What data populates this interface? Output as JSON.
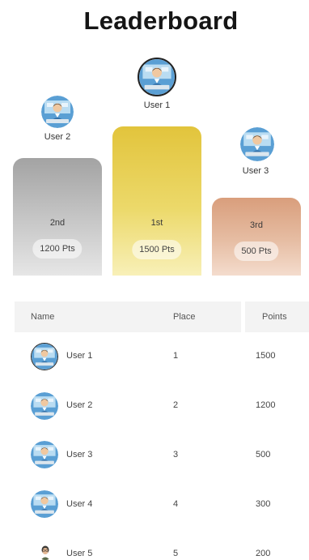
{
  "header": {
    "title": "Leaderboard"
  },
  "podium": [
    {
      "rank": 2,
      "user": "User 2",
      "place": "2nd",
      "points": "1200 Pts",
      "avatar": "developer-avatar"
    },
    {
      "rank": 1,
      "user": "User 1",
      "place": "1st",
      "points": "1500 Pts",
      "avatar": "developer-avatar"
    },
    {
      "rank": 3,
      "user": "User 3",
      "place": "3rd",
      "points": "500 Pts",
      "avatar": "developer-avatar"
    }
  ],
  "table": {
    "columns": [
      "Name",
      "Place",
      "Points"
    ],
    "rows": [
      {
        "name": "User 1",
        "place": "1",
        "points": "1500",
        "avatar": "developer-avatar"
      },
      {
        "name": "User 2",
        "place": "2",
        "points": "1200",
        "avatar": "developer-avatar"
      },
      {
        "name": "User 3",
        "place": "3",
        "points": "500",
        "avatar": "developer-avatar"
      },
      {
        "name": "User 4",
        "place": "4",
        "points": "300",
        "avatar": "developer-avatar"
      },
      {
        "name": "User 5",
        "place": "5",
        "points": "200",
        "avatar": "person-avatar"
      }
    ]
  },
  "colors": {
    "gold": "#e2c43c",
    "silver": "#a3a3a3",
    "bronze": "#d99e7c",
    "header_bg": "#f3f3f3"
  }
}
